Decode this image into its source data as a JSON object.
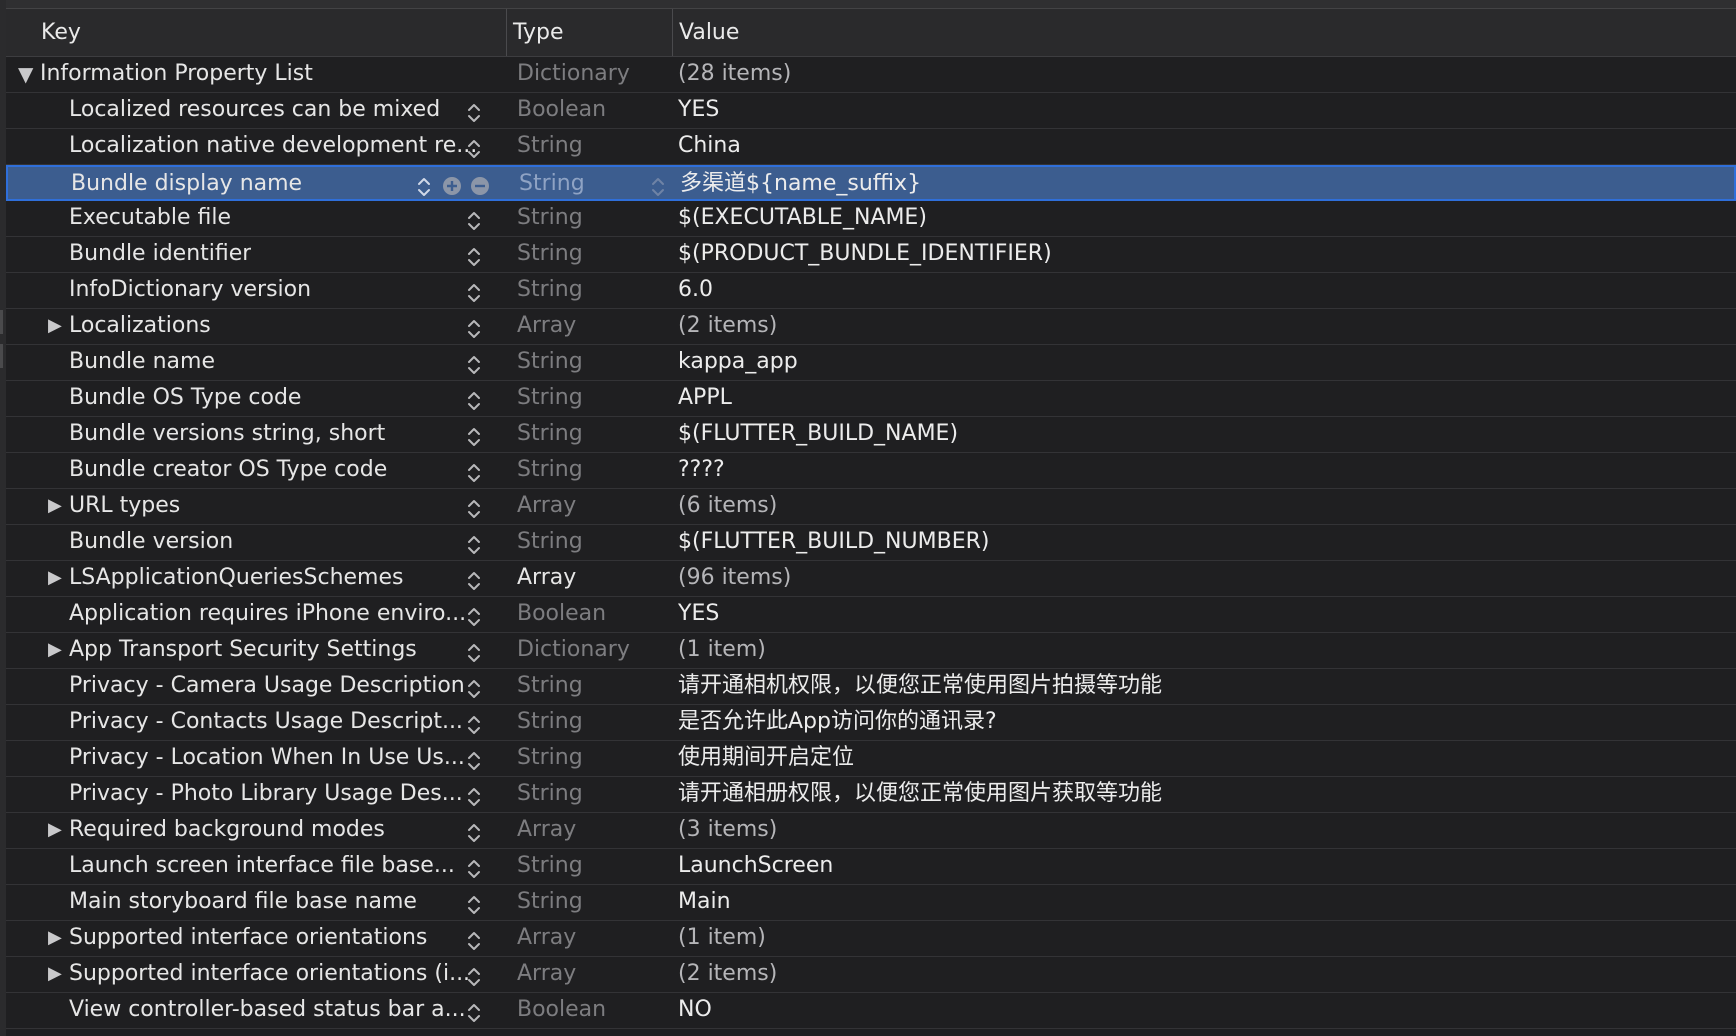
{
  "header": {
    "key_label": "Key",
    "type_label": "Type",
    "value_label": "Value"
  },
  "rows": [
    {
      "key": "Information Property List",
      "type": "Dictionary",
      "value": "(28 items)",
      "disclosure": "expanded",
      "level": 0
    },
    {
      "key": "Localized resources can be mixed",
      "type": "Boolean",
      "value": "YES",
      "disclosure": "none",
      "level": 1
    },
    {
      "key": "Localization native development re...",
      "type": "String",
      "value": "China",
      "disclosure": "none",
      "level": 1
    },
    {
      "key": "Bundle display name",
      "type": "String",
      "value": "多渠道${name_suffix}",
      "disclosure": "none",
      "level": 1,
      "selected": true
    },
    {
      "key": "Executable file",
      "type": "String",
      "value": "$(EXECUTABLE_NAME)",
      "disclosure": "none",
      "level": 1
    },
    {
      "key": "Bundle identifier",
      "type": "String",
      "value": "$(PRODUCT_BUNDLE_IDENTIFIER)",
      "disclosure": "none",
      "level": 1
    },
    {
      "key": "InfoDictionary version",
      "type": "String",
      "value": "6.0",
      "disclosure": "none",
      "level": 1
    },
    {
      "key": "Localizations",
      "type": "Array",
      "value": "(2 items)",
      "disclosure": "collapsed",
      "level": 1
    },
    {
      "key": "Bundle name",
      "type": "String",
      "value": "kappa_app",
      "disclosure": "none",
      "level": 1
    },
    {
      "key": "Bundle OS Type code",
      "type": "String",
      "value": "APPL",
      "disclosure": "none",
      "level": 1
    },
    {
      "key": "Bundle versions string, short",
      "type": "String",
      "value": "$(FLUTTER_BUILD_NAME)",
      "disclosure": "none",
      "level": 1
    },
    {
      "key": "Bundle creator OS Type code",
      "type": "String",
      "value": "????",
      "disclosure": "none",
      "level": 1
    },
    {
      "key": "URL types",
      "type": "Array",
      "value": "(6 items)",
      "disclosure": "collapsed",
      "level": 1
    },
    {
      "key": "Bundle version",
      "type": "String",
      "value": "$(FLUTTER_BUILD_NUMBER)",
      "disclosure": "none",
      "level": 1
    },
    {
      "key": "LSApplicationQueriesSchemes",
      "type": "Array",
      "value": "(96 items)",
      "disclosure": "collapsed",
      "level": 1,
      "type_strong": true
    },
    {
      "key": "Application requires iPhone enviro...",
      "type": "Boolean",
      "value": "YES",
      "disclosure": "none",
      "level": 1
    },
    {
      "key": "App Transport Security Settings",
      "type": "Dictionary",
      "value": "(1 item)",
      "disclosure": "collapsed",
      "level": 1
    },
    {
      "key": "Privacy - Camera Usage Description",
      "type": "String",
      "value": "请开通相机权限，以便您正常使用图片拍摄等功能",
      "disclosure": "none",
      "level": 1
    },
    {
      "key": "Privacy - Contacts Usage Descript...",
      "type": "String",
      "value": "是否允许此App访问你的通讯录?",
      "disclosure": "none",
      "level": 1
    },
    {
      "key": "Privacy - Location When In Use Us...",
      "type": "String",
      "value": "使用期间开启定位",
      "disclosure": "none",
      "level": 1
    },
    {
      "key": "Privacy - Photo Library Usage Des...",
      "type": "String",
      "value": "请开通相册权限，以便您正常使用图片获取等功能",
      "disclosure": "none",
      "level": 1
    },
    {
      "key": "Required background modes",
      "type": "Array",
      "value": "(3 items)",
      "disclosure": "collapsed",
      "level": 1
    },
    {
      "key": "Launch screen interface file base...",
      "type": "String",
      "value": "LaunchScreen",
      "disclosure": "none",
      "level": 1
    },
    {
      "key": "Main storyboard file base name",
      "type": "String",
      "value": "Main",
      "disclosure": "none",
      "level": 1
    },
    {
      "key": "Supported interface orientations",
      "type": "Array",
      "value": "(1 item)",
      "disclosure": "collapsed",
      "level": 1
    },
    {
      "key": "Supported interface orientations (i...",
      "type": "Array",
      "value": "(2 items)",
      "disclosure": "collapsed",
      "level": 1
    },
    {
      "key": "View controller-based status bar a...",
      "type": "Boolean",
      "value": "NO",
      "disclosure": "none",
      "level": 1
    }
  ],
  "icons": {
    "expanded": "disclosure-expanded-icon",
    "collapsed": "disclosure-collapsed-icon",
    "stepper": "stepper-updown-icon",
    "add": "add-row-icon",
    "remove": "remove-row-icon"
  },
  "colors": {
    "background": "#1f1f21",
    "selection": "#3c5d8f",
    "selection_border": "#2f6fda",
    "muted_type": "#7d7d80"
  }
}
